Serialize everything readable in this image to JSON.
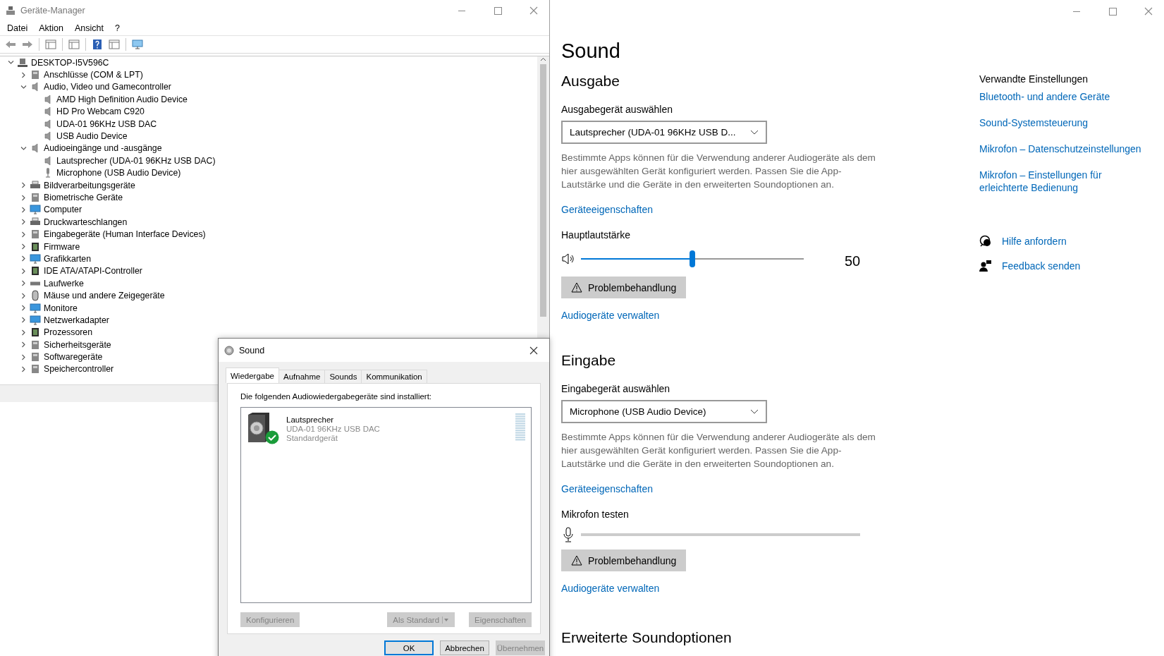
{
  "device_manager": {
    "title": "Geräte-Manager",
    "menu": [
      "Datei",
      "Aktion",
      "Ansicht",
      "?"
    ],
    "tree": [
      {
        "label": "DESKTOP-I5V596C",
        "expanded": true,
        "children": [
          {
            "label": "Anschlüsse (COM & LPT)",
            "expanded": false
          },
          {
            "label": "Audio, Video und Gamecontroller",
            "expanded": true,
            "children": [
              {
                "label": "AMD High Definition Audio Device"
              },
              {
                "label": "HD Pro Webcam C920"
              },
              {
                "label": "UDA-01 96KHz USB DAC"
              },
              {
                "label": "USB Audio Device"
              }
            ]
          },
          {
            "label": "Audioeingänge und -ausgänge",
            "expanded": true,
            "children": [
              {
                "label": "Lautsprecher (UDA-01 96KHz USB DAC)"
              },
              {
                "label": "Microphone (USB Audio Device)"
              }
            ]
          },
          {
            "label": "Bildverarbeitungsgeräte",
            "expanded": false
          },
          {
            "label": "Biometrische Geräte",
            "expanded": false
          },
          {
            "label": "Computer",
            "expanded": false
          },
          {
            "label": "Druckwarteschlangen",
            "expanded": false
          },
          {
            "label": "Eingabegeräte (Human Interface Devices)",
            "expanded": false
          },
          {
            "label": "Firmware",
            "expanded": false
          },
          {
            "label": "Grafikkarten",
            "expanded": false
          },
          {
            "label": "IDE ATA/ATAPI-Controller",
            "expanded": false
          },
          {
            "label": "Laufwerke",
            "expanded": false
          },
          {
            "label": "Mäuse und andere Zeigegeräte",
            "expanded": false
          },
          {
            "label": "Monitore",
            "expanded": false
          },
          {
            "label": "Netzwerkadapter",
            "expanded": false
          },
          {
            "label": "Prozessoren",
            "expanded": false
          },
          {
            "label": "Sicherheitsgeräte",
            "expanded": false
          },
          {
            "label": "Softwaregeräte",
            "expanded": false
          },
          {
            "label": "Speichercontroller",
            "expanded": false
          }
        ]
      }
    ]
  },
  "sound_dialog": {
    "title": "Sound",
    "tabs": [
      {
        "label": "Wiedergabe",
        "selected": true
      },
      {
        "label": "Aufnahme",
        "selected": false
      },
      {
        "label": "Sounds",
        "selected": false
      },
      {
        "label": "Kommunikation",
        "selected": false
      }
    ],
    "intro": "Die folgenden Audiowiedergabegeräte sind installiert:",
    "devices": [
      {
        "name": "Lautsprecher",
        "detail": "UDA-01 96KHz USB DAC",
        "status": "Standardgerät",
        "default": true
      }
    ],
    "buttons": [
      {
        "label": "Konfigurieren",
        "disabled": true,
        "kind": "plain"
      },
      {
        "label": "Als Standard",
        "disabled": true,
        "kind": "split"
      },
      {
        "label": "Eigenschaften",
        "disabled": true,
        "kind": "plain"
      }
    ],
    "footer_buttons": [
      {
        "label": "OK",
        "default": true,
        "disabled": false
      },
      {
        "label": "Abbrechen",
        "default": false,
        "disabled": false
      },
      {
        "label": "Übernehmen",
        "default": false,
        "disabled": true
      }
    ]
  },
  "settings": {
    "title": "Sound",
    "sections": [
      {
        "heading": "Ausgabe",
        "select_label": "Ausgabegerät auswählen",
        "select_value": "Lautsprecher (UDA-01 96KHz USB D...",
        "description": "Bestimmte Apps können für die Verwendung anderer Audiogeräte als dem hier ausgewählten Gerät konfiguriert werden. Passen Sie die App-Lautstärke und die Geräte in den erweiterten Soundoptionen an.",
        "properties_link": "Geräteeigenschaften",
        "meter_label": "Hauptlautstärke",
        "kind": "volume",
        "level": 0.5,
        "reading": "50",
        "troubleshoot": "Problembehandlung",
        "manage_link": "Audiogeräte verwalten"
      },
      {
        "heading": "Eingabe",
        "select_label": "Eingabegerät auswählen",
        "select_value": "Microphone (USB Audio Device)",
        "description": "Bestimmte Apps können für die Verwendung anderer Audiogeräte als dem hier ausgewählten Gerät konfiguriert werden. Passen Sie die App-Lautstärke und die Geräte in den erweiterten Soundoptionen an.",
        "properties_link": "Geräteeigenschaften",
        "meter_label": "Mikrofon testen",
        "kind": "microphone",
        "level": 0,
        "troubleshoot": "Problembehandlung",
        "manage_link": "Audiogeräte verwalten"
      }
    ],
    "advanced_heading": "Erweiterte Soundoptionen",
    "related": {
      "heading": "Verwandte Einstellungen",
      "links": [
        "Bluetooth- und andere Geräte",
        "Sound-Systemsteuerung",
        "Mikrofon – Datenschutzeinstellungen",
        "Mikrofon – Einstellungen für erleichterte Bedienung"
      ]
    },
    "help": [
      {
        "label": "Hilfe anfordern",
        "kind": "help"
      },
      {
        "label": "Feedback senden",
        "kind": "feedback"
      }
    ]
  }
}
